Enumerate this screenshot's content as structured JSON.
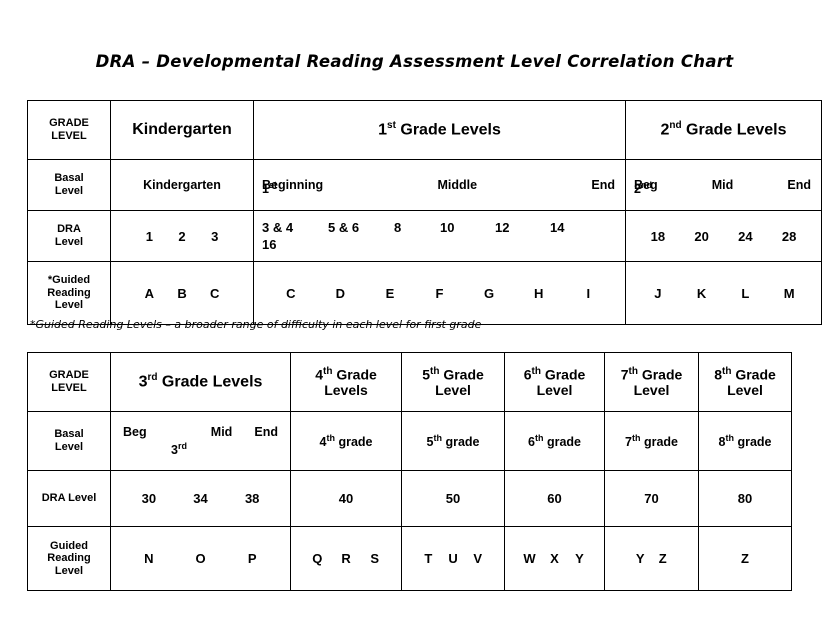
{
  "title": "DRA – Developmental Reading Assessment Level Correlation Chart",
  "footnote": "*Guided Reading Levels – a broader range of difficulty in each level for first grade",
  "table1": {
    "row_labels": {
      "grade_level": "GRADE\nLEVEL",
      "grade_level_1": "GRADE",
      "grade_level_2": "LEVEL",
      "basal_1": "Basal",
      "basal_2": "Level",
      "dra_1": "DRA",
      "dra_2": "Level",
      "guided_1": "*Guided",
      "guided_2": "Reading",
      "guided_3": "Level"
    },
    "grade_headers": [
      {
        "text": "Kindergarten",
        "sup": ""
      },
      {
        "text": "1",
        "sup": "st",
        "tail": " Grade Levels"
      },
      {
        "text": "2",
        "sup": "nd",
        "tail": " Grade Levels"
      }
    ],
    "basal": {
      "kindergarten": "Kindergarten",
      "first": [
        "Beginning",
        "Middle",
        "End"
      ],
      "first_sub": "1",
      "first_sub_sup": "st",
      "second": [
        "Beg",
        "Mid",
        "End"
      ],
      "second_sub": "2",
      "second_sub_sup": "nd"
    },
    "dra": {
      "kindergarten": [
        "1",
        "2",
        "3"
      ],
      "first": [
        "3 & 4",
        "5 & 6",
        "8",
        "10",
        "12",
        "14"
      ],
      "first_wrap": "16",
      "second": [
        "18",
        "20",
        "24",
        "28"
      ]
    },
    "guided": {
      "kindergarten": [
        "A",
        "B",
        "C"
      ],
      "first": [
        "C",
        "D",
        "E",
        "F",
        "G",
        "H",
        "I"
      ],
      "second": [
        "J",
        "K",
        "L",
        "M"
      ]
    }
  },
  "table2": {
    "row_labels": {
      "grade_1": "GRADE",
      "grade_2": "LEVEL",
      "basal_1": "Basal",
      "basal_2": "Level",
      "dra": "DRA Level",
      "guided_1": "Guided",
      "guided_2": "Reading",
      "guided_3": "Level"
    },
    "grade_headers": [
      {
        "num": "3",
        "sup": "rd",
        "tail": " Grade Levels",
        "lines": 1
      },
      {
        "num": "4",
        "sup": "th",
        "tail": " Grade",
        "line2": "Levels"
      },
      {
        "num": "5",
        "sup": "th",
        "tail": " Grade",
        "line2": "Level"
      },
      {
        "num": "6",
        "sup": "th",
        "tail": " Grade",
        "line2": "Level"
      },
      {
        "num": "7",
        "sup": "th",
        "tail": " Grade",
        "line2": "Level"
      },
      {
        "num": "8",
        "sup": "th",
        "tail": " Grade",
        "line2": "Level"
      }
    ],
    "basal": {
      "third": [
        "Beg",
        "Mid",
        "End"
      ],
      "third_sub": "3",
      "third_sub_sup": "rd",
      "fourth": {
        "num": "4",
        "sup": "th",
        "tail": " grade"
      },
      "fifth": {
        "num": "5",
        "sup": "th",
        "tail": " grade"
      },
      "sixth": {
        "num": "6",
        "sup": "th",
        "tail": " grade"
      },
      "seventh": {
        "num": "7",
        "sup": "th",
        "tail": " grade"
      },
      "eighth": {
        "num": "8",
        "sup": "th",
        "tail": " grade"
      }
    },
    "dra": {
      "third": [
        "30",
        "34",
        "38"
      ],
      "fourth": "40",
      "fifth": "50",
      "sixth": "60",
      "seventh": "70",
      "eighth": "80"
    },
    "guided": {
      "third": [
        "N",
        "O",
        "P"
      ],
      "fourth": [
        "Q",
        "R",
        "S"
      ],
      "fifth": [
        "T",
        "U",
        "V"
      ],
      "sixth": [
        "W",
        "X",
        "Y"
      ],
      "seventh": [
        "Y",
        "Z"
      ],
      "eighth": [
        "Z"
      ]
    }
  },
  "colors": {
    "header_bg": "#d9d9d9",
    "border": "#000000",
    "text": "#000000"
  }
}
